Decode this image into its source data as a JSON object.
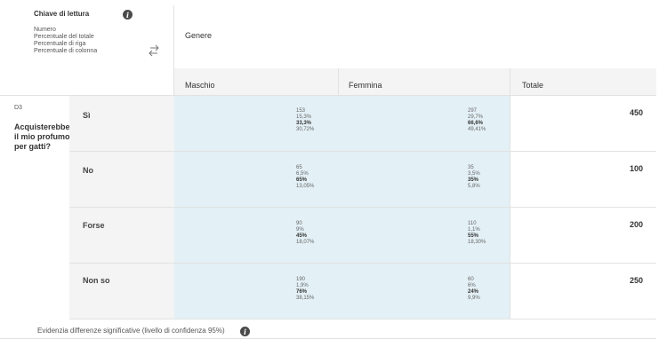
{
  "legend": {
    "title": "Chiave di lettura",
    "items": [
      "Numero",
      "Percentuale del totale",
      "Percentuale di riga",
      "Percentuale di colonna"
    ]
  },
  "header": {
    "group": "Genere",
    "columns": [
      "Maschio",
      "Femmina",
      "Totale"
    ]
  },
  "question": {
    "code": "D3",
    "text": "Acquisterebbe il mio profumo per gatti?"
  },
  "rows": [
    {
      "label": "Sì",
      "male": {
        "n": "153",
        "tot": "15,3%",
        "row": "33,3%",
        "col": "30,72%"
      },
      "female": {
        "n": "297",
        "tot": "29,7%",
        "row": "66,6%",
        "col": "49,41%"
      },
      "total": "450"
    },
    {
      "label": "No",
      "male": {
        "n": "65",
        "tot": "6,5%",
        "row": "65%",
        "col": "13,05%"
      },
      "female": {
        "n": "35",
        "tot": "3,5%",
        "row": "35%",
        "col": "5,8%"
      },
      "total": "100"
    },
    {
      "label": "Forse",
      "male": {
        "n": "90",
        "tot": "9%",
        "row": "45%",
        "col": "18,07%"
      },
      "female": {
        "n": "110",
        "tot": "1,1%",
        "row": "55%",
        "col": "18,30%"
      },
      "total": "200"
    },
    {
      "label": "Non so",
      "male": {
        "n": "190",
        "tot": "1,9%",
        "row": "76%",
        "col": "38,15%"
      },
      "female": {
        "n": "60",
        "tot": "6%",
        "row": "24%",
        "col": "9,9%"
      },
      "total": "250"
    }
  ],
  "footer": {
    "text": "Evidenzia differenze significative (livello di confidenza 95%)"
  }
}
